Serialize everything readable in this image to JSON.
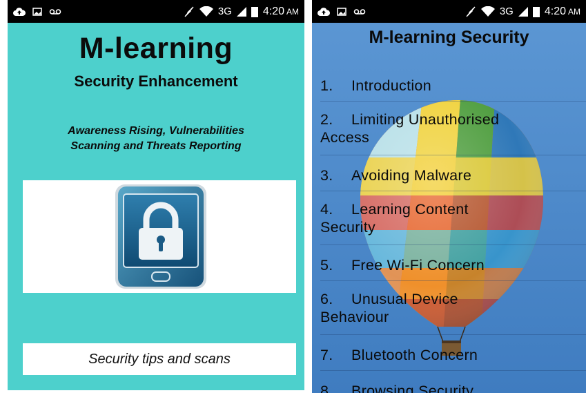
{
  "status_bar": {
    "network": "3G",
    "time": "4:20",
    "ampm": "AM",
    "icons": [
      "cloud-upload-icon",
      "image-icon",
      "voicemail-icon",
      "mute-icon",
      "wifi-icon",
      "signal-icon",
      "battery-icon"
    ]
  },
  "left_screen": {
    "title": "M-learning",
    "subtitle": "Security Enhancement",
    "tagline_line1": "Awareness Rising, Vulnerabilities",
    "tagline_line2": "Scanning and Threats Reporting",
    "logo_icon": "phone-padlock-icon",
    "button_label": "Security tips and scans",
    "colors": {
      "background": "#4dd0cc",
      "panel": "#ffffff"
    }
  },
  "right_screen": {
    "title": "M-learning Security",
    "background_image": "hot-air-balloon",
    "items": [
      {
        "num": "1.",
        "label": "Introduction"
      },
      {
        "num": "2.",
        "label": "Limiting Unauthorised",
        "label2": "Access"
      },
      {
        "num": "3.",
        "label": "Avoiding Malware"
      },
      {
        "num": "4.",
        "label": "Learning Content",
        "label2": "Security"
      },
      {
        "num": "5.",
        "label": "Free Wi-Fi Concern"
      },
      {
        "num": "6.",
        "label": "Unusual Device",
        "label2": "Behaviour"
      },
      {
        "num": "7.",
        "label": "Bluetooth Concern"
      },
      {
        "num": "8.",
        "label": "Browsing Security"
      }
    ],
    "colors": {
      "sky": "#4a86c8"
    }
  }
}
